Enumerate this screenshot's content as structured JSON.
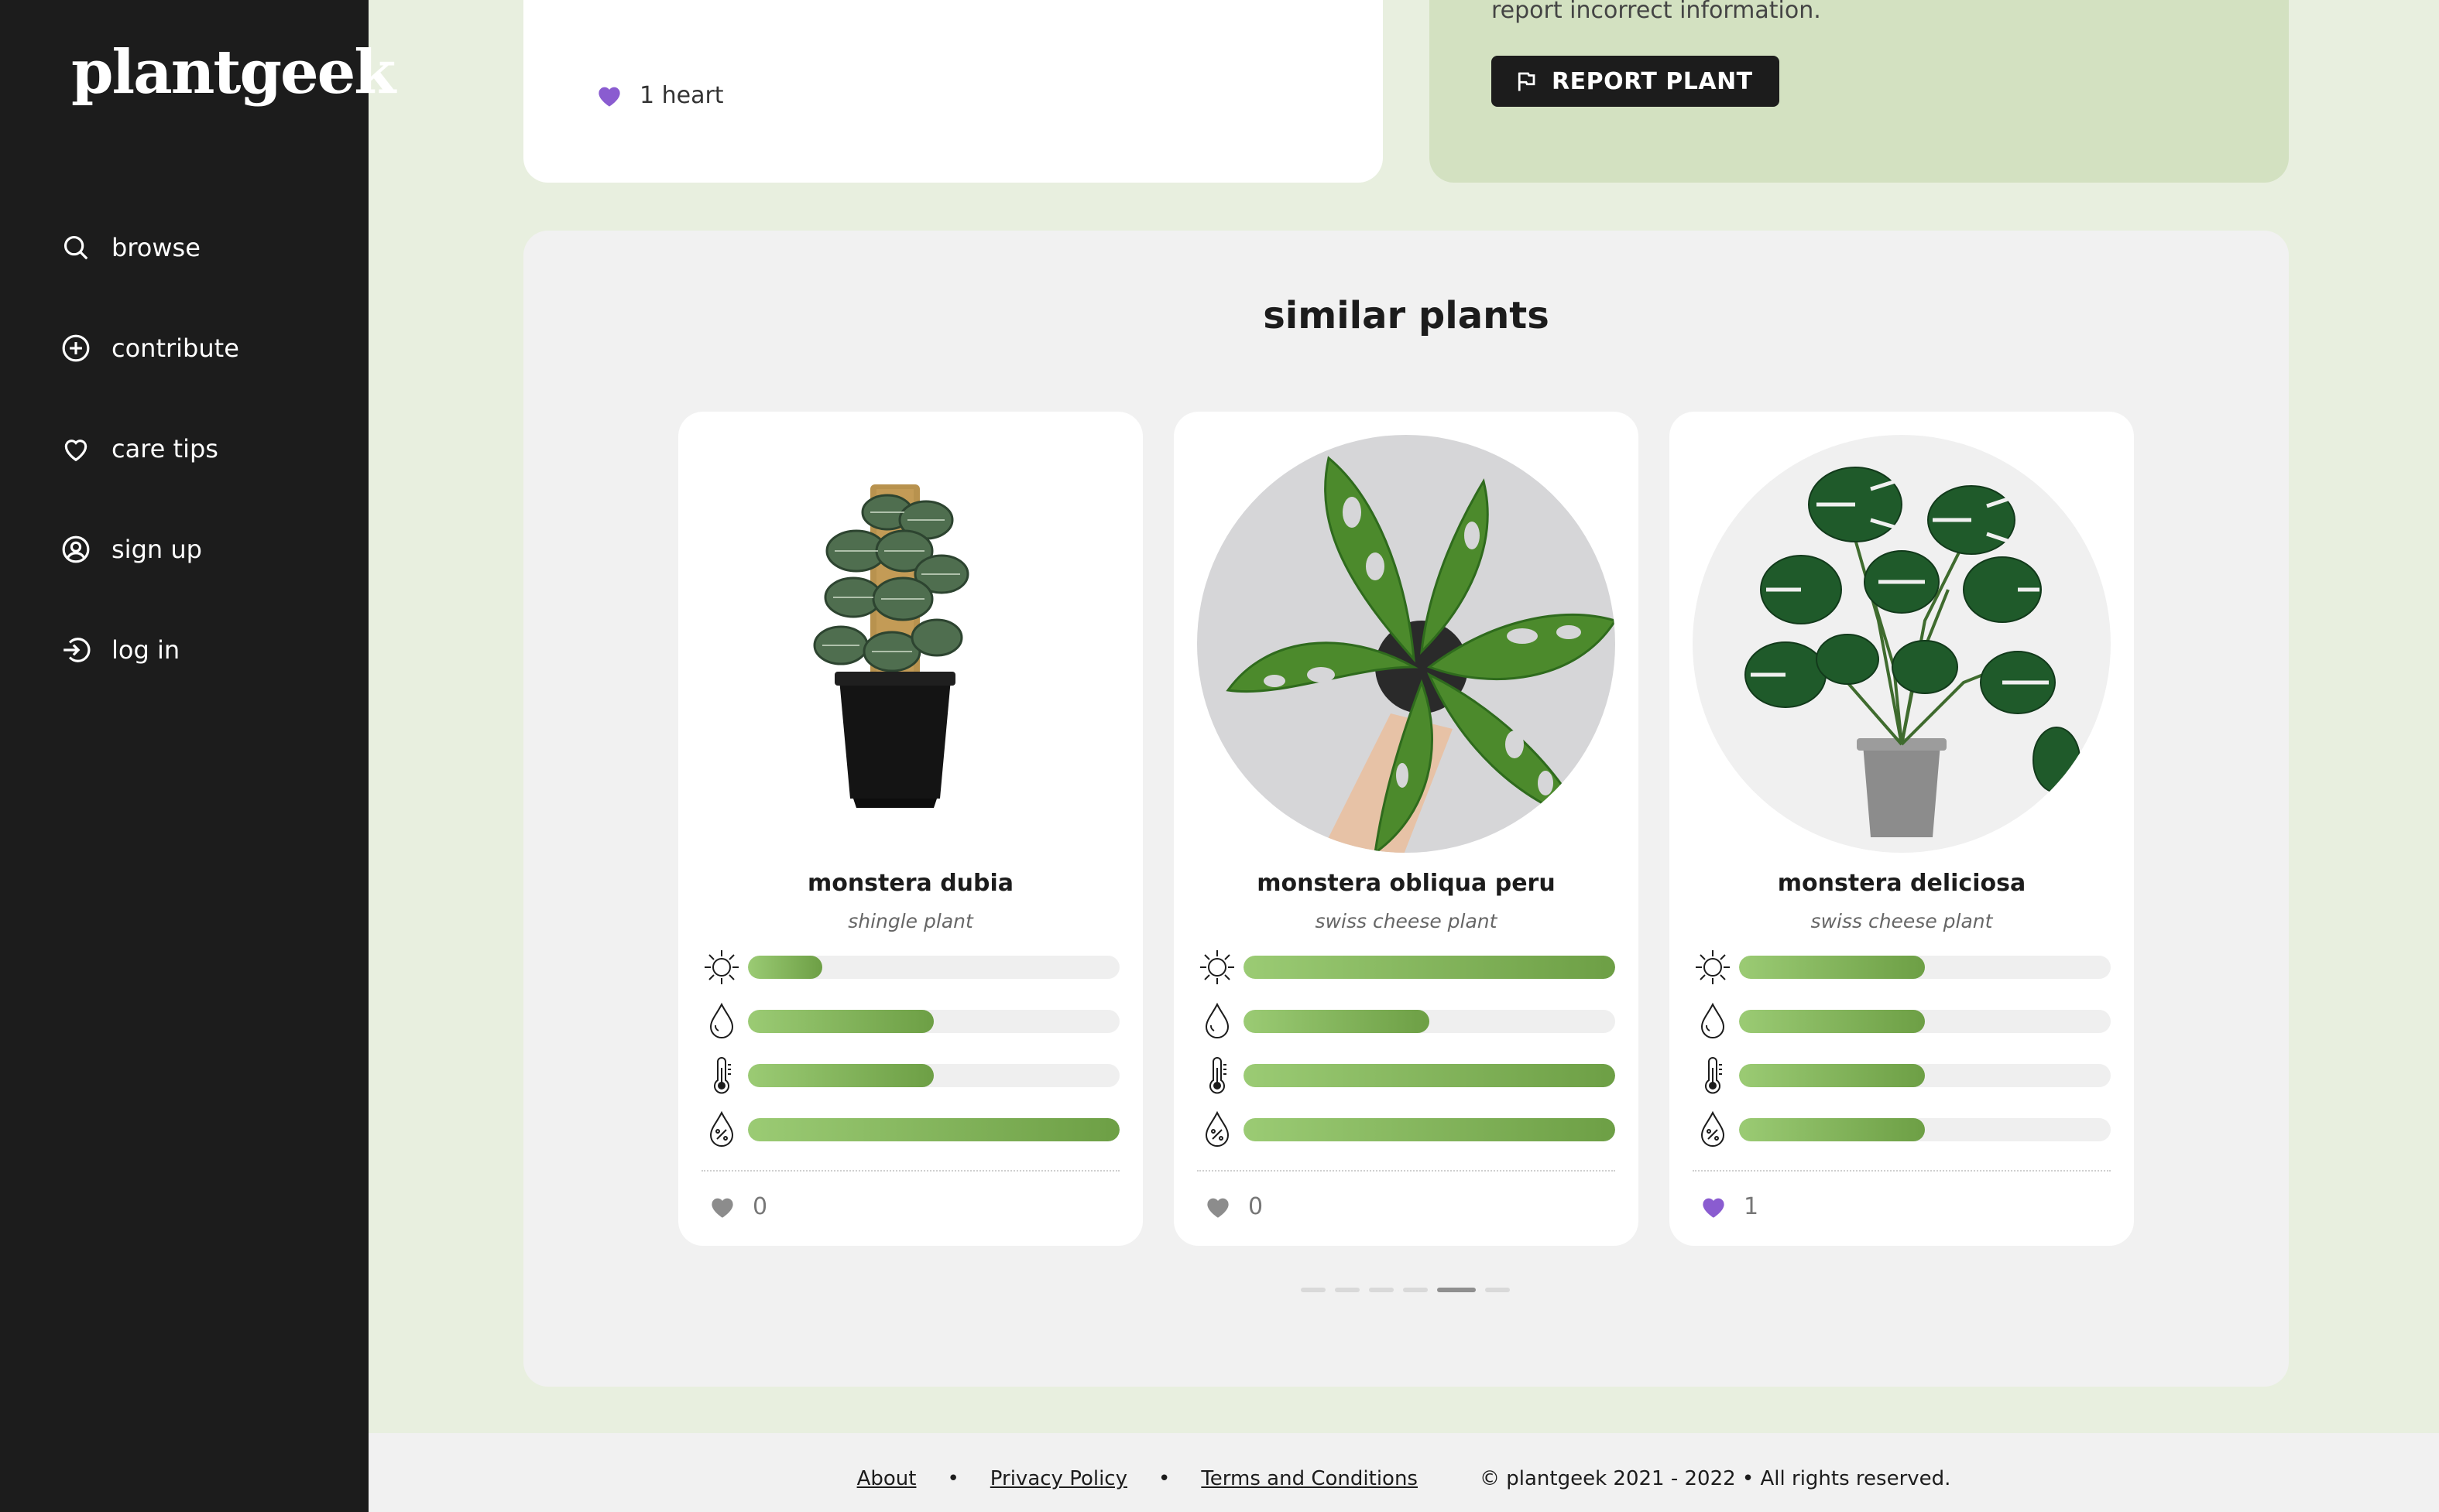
{
  "brand": {
    "logo": "plantgeek"
  },
  "sidebar": {
    "items": [
      {
        "label": "browse",
        "icon": "search-icon"
      },
      {
        "label": "contribute",
        "icon": "plus-circle-icon"
      },
      {
        "label": "care tips",
        "icon": "heart-outline-icon"
      },
      {
        "label": "sign up",
        "icon": "user-circle-icon"
      },
      {
        "label": "log in",
        "icon": "login-icon"
      }
    ]
  },
  "plant_detail": {
    "hearts_text": "1 heart",
    "report_text": "report incorrect information.",
    "report_button": "REPORT PLANT"
  },
  "similar": {
    "title": "similar plants",
    "cards": [
      {
        "name": "monstera dubia",
        "common": "shingle plant",
        "light": 0.2,
        "water": 0.5,
        "temperature": 0.5,
        "humidity": 1.0,
        "hearts": "0",
        "liked": false
      },
      {
        "name": "monstera obliqua peru",
        "common": "swiss cheese plant",
        "light": 1.0,
        "water": 0.5,
        "temperature": 1.0,
        "humidity": 1.0,
        "hearts": "0",
        "liked": false
      },
      {
        "name": "monstera deliciosa",
        "common": "swiss cheese plant",
        "light": 0.5,
        "water": 0.5,
        "temperature": 0.5,
        "humidity": 0.5,
        "hearts": "1",
        "liked": true
      }
    ],
    "carousel_pages": 6,
    "carousel_active": 5
  },
  "footer": {
    "about": "About",
    "privacy": "Privacy Policy",
    "terms": "Terms and Conditions",
    "bullet": "•",
    "copyright": "© plantgeek 2021 - 2022 • All rights reserved."
  },
  "colors": {
    "sidebar_bg": "#1c1c1c",
    "page_bg": "#e8efdf",
    "accent_green": "#6d9f45",
    "heart_purple": "#8a5cd0",
    "heart_grey": "#8c8c8c"
  }
}
